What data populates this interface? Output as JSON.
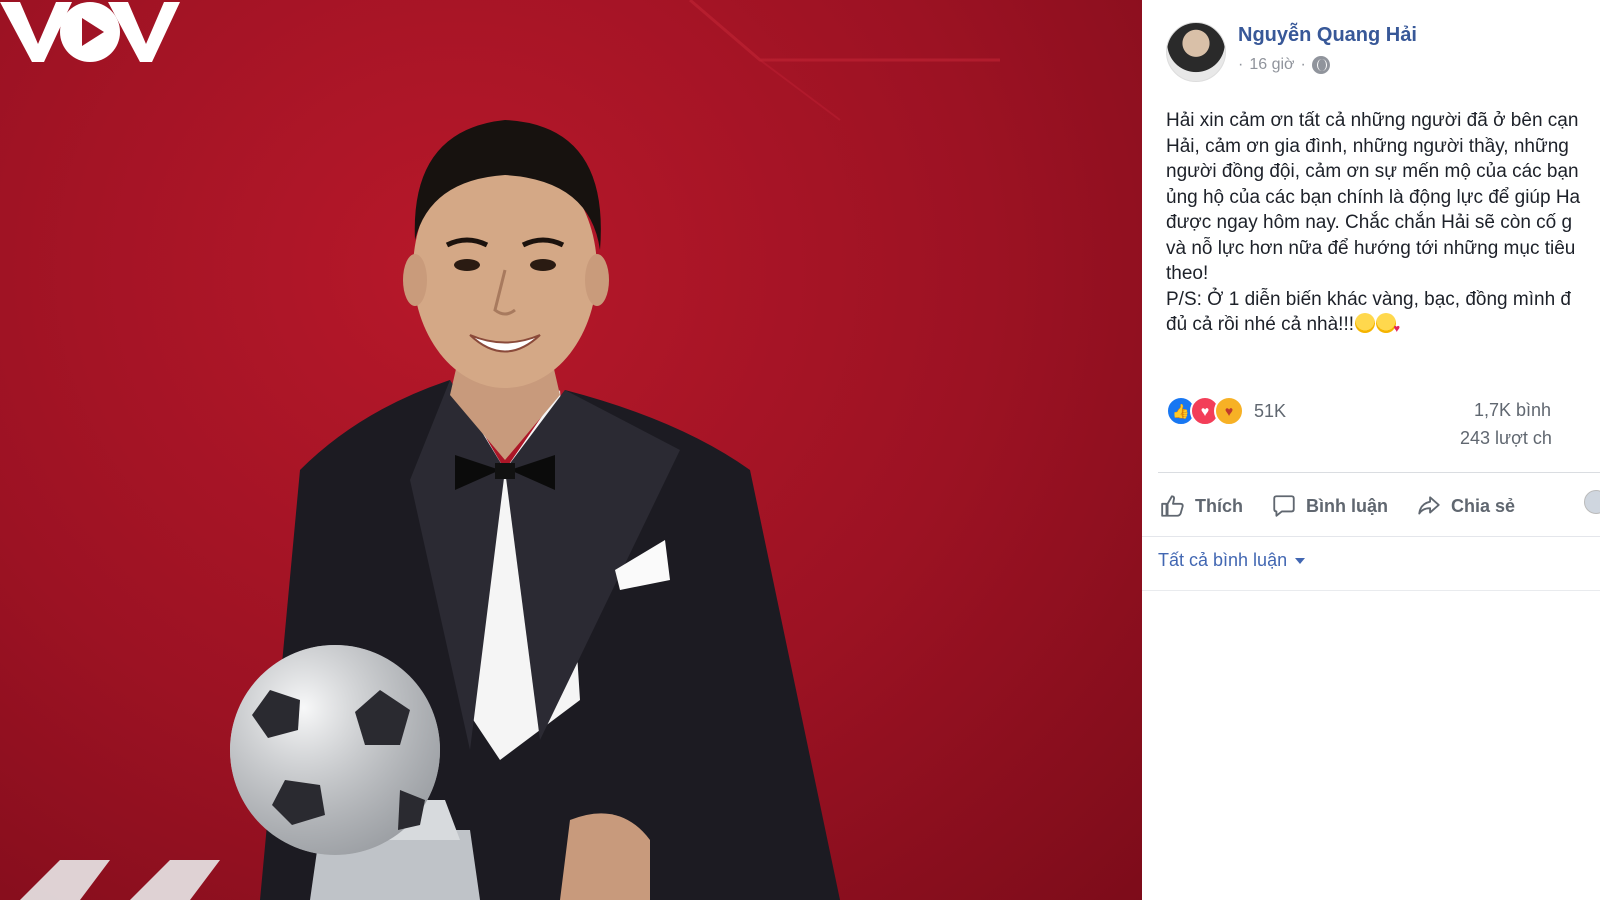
{
  "brand": {
    "logo_text": "VOV"
  },
  "post": {
    "author": "Nguyễn Quang Hải",
    "time": "16 giờ",
    "separator": "·",
    "text_lines": [
      "Hải xin cảm ơn tất cả những người đã ở bên cạn",
      "Hải, cảm ơn gia đình, những người thầy, những",
      "người đồng đội, cảm ơn sự mến mộ của các bạn",
      "ủng hộ của các bạn chính là động lực để giúp Ha",
      "được ngay hôm nay. Chắc chắn Hải sẽ còn cố g",
      "và nỗ lực hơn nữa để hướng tới những mục tiêu",
      "theo!",
      "P/S: Ở 1 diễn biến khác vàng, bạc, đồng mình đ",
      "đủ cả rồi nhé cả nhà!!!"
    ],
    "emojis": [
      "rolling-laughing",
      "smiling-hearts"
    ],
    "reactions": {
      "count": "51K",
      "types": [
        "like",
        "love",
        "care"
      ]
    },
    "comments_count": "1,7K bình",
    "shares_count": "243 lượt ch"
  },
  "actions": {
    "like": "Thích",
    "comment": "Bình luận",
    "share": "Chia sẻ"
  },
  "comments_filter": {
    "label": "Tất cả bình luận"
  },
  "colors": {
    "background_red": "#9c1223",
    "facebook_blue": "#385898",
    "link_blue": "#4267b2"
  }
}
